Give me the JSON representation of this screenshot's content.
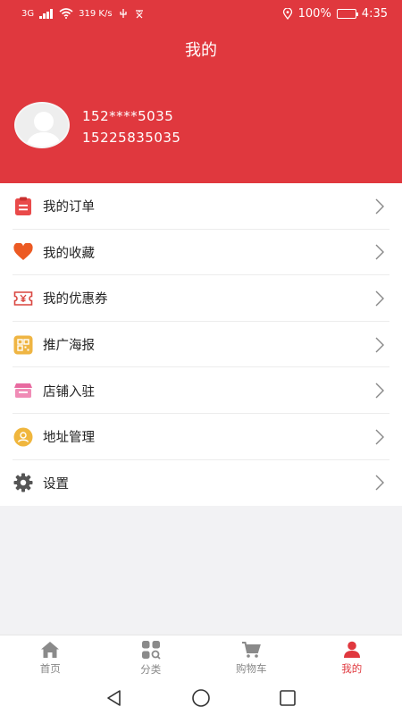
{
  "status_bar": {
    "network": "3G",
    "speed": "319 K/s",
    "battery": "100%",
    "time": "4:35"
  },
  "header": {
    "title": "我的"
  },
  "user": {
    "masked_phone": "152****5035",
    "phone": "15225835035"
  },
  "menu": [
    {
      "label": "我的订单",
      "icon": "order-icon",
      "color": "#e94a4a"
    },
    {
      "label": "我的收藏",
      "icon": "heart-icon",
      "color": "#ec5a23"
    },
    {
      "label": "我的优惠券",
      "icon": "coupon-icon",
      "color": "#d9453f"
    },
    {
      "label": "推广海报",
      "icon": "qr-icon",
      "color": "#efb543"
    },
    {
      "label": "店铺入驻",
      "icon": "store-icon",
      "color": "#e86aa0"
    },
    {
      "label": "地址管理",
      "icon": "location-icon",
      "color": "#f0b63d"
    },
    {
      "label": "设置",
      "icon": "gear-icon",
      "color": "#555555"
    }
  ],
  "tabbar": [
    {
      "label": "首页",
      "icon": "home-icon",
      "active": false
    },
    {
      "label": "分类",
      "icon": "category-icon",
      "active": false
    },
    {
      "label": "购物车",
      "icon": "cart-icon",
      "active": false
    },
    {
      "label": "我的",
      "icon": "user-icon",
      "active": true
    }
  ],
  "colors": {
    "accent": "#e0383e",
    "background": "#f2f2f4"
  }
}
